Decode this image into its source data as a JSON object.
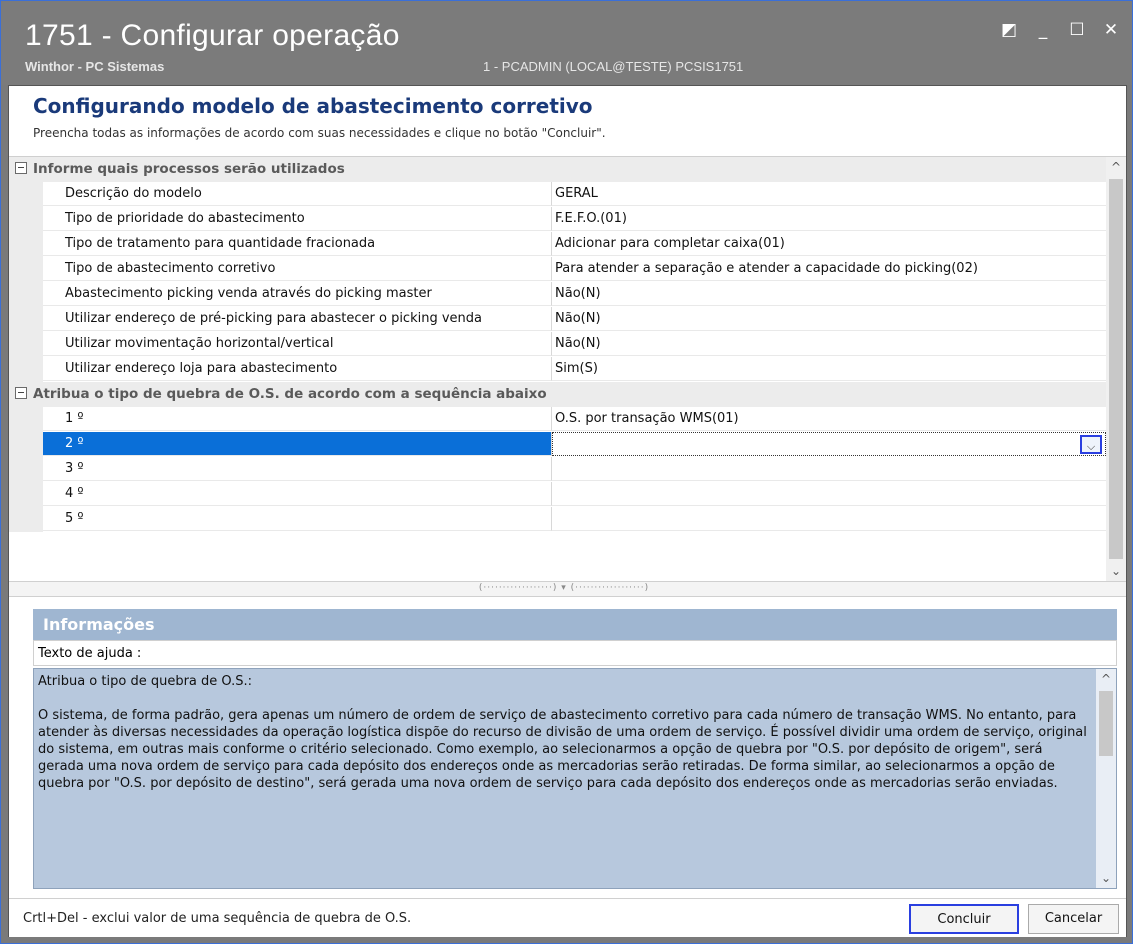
{
  "window": {
    "title": "1751 - Configurar operação",
    "subtitle": "Winthor - PC Sistemas",
    "user_info": "1 - PCADMIN (LOCAL@TESTE)  PCSIS1751",
    "buttons": [
      "restore",
      "minimize",
      "maximize",
      "close"
    ]
  },
  "header": {
    "title": "Configurando modelo de abastecimento corretivo",
    "subtitle": "Preencha todas as informações de acordo com suas necessidades e clique no botão \"Concluir\"."
  },
  "grid": {
    "sections": [
      {
        "label": "Informe quais processos serão utilizados",
        "rows": [
          {
            "name": "Descrição do modelo",
            "value": "GERAL"
          },
          {
            "name": "Tipo de prioridade do abastecimento",
            "value": "F.E.F.O.(01)"
          },
          {
            "name": "Tipo de tratamento para quantidade fracionada",
            "value": "Adicionar para completar caixa(01)"
          },
          {
            "name": "Tipo de abastecimento corretivo",
            "value": "Para atender a separação e atender a capacidade do picking(02)"
          },
          {
            "name": "Abastecimento picking venda através do picking master",
            "value": "Não(N)"
          },
          {
            "name": "Utilizar endereço de pré-picking para abastecer o picking venda",
            "value": "Não(N)"
          },
          {
            "name": "Utilizar movimentação horizontal/vertical",
            "value": "Não(N)"
          },
          {
            "name": "Utilizar endereço loja para abastecimento",
            "value": "Sim(S)"
          }
        ]
      },
      {
        "label": "Atribua o tipo de quebra de O.S. de acordo com a sequência abaixo",
        "rows": [
          {
            "name": "1 º",
            "value": "O.S. por transação WMS(01)"
          },
          {
            "name": "2 º",
            "value": ""
          },
          {
            "name": "3 º",
            "value": ""
          },
          {
            "name": "4 º",
            "value": ""
          },
          {
            "name": "5 º",
            "value": ""
          }
        ]
      }
    ],
    "selected_row": "2 º"
  },
  "info": {
    "title": "Informações",
    "help_label": "Texto de ajuda :",
    "help_text": "Atribua o tipo de quebra de O.S.:\n\nO sistema, de forma padrão, gera apenas um número de ordem de serviço de abastecimento corretivo para cada número de transação WMS. No entanto, para atender às diversas necessidades da operação logística dispõe do recurso de divisão de uma ordem de serviço. É possível dividir uma ordem de serviço, original do sistema, em outras mais conforme o critério selecionado. Como exemplo, ao selecionarmos a opção de quebra por \"O.S. por depósito de origem\", será gerada uma nova ordem de serviço para cada depósito dos endereços onde as mercadorias serão retiradas. De forma similar, ao selecionarmos a opção de quebra por \"O.S. por depósito de destino\", será gerada uma nova ordem de serviço para cada depósito dos endereços onde as mercadorias serão enviadas."
  },
  "footer": {
    "hint": "Crtl+Del - exclui valor de uma sequência de quebra de O.S.",
    "concluir_label": "Concluir",
    "cancelar_label": "Cancelar"
  },
  "colors": {
    "titlebar": "#7b7b7b",
    "selection": "#0a6fd8",
    "info_header": "#9fb6d1",
    "help_background": "#b7c8dd",
    "highlight_border": "#2a3fe0"
  }
}
